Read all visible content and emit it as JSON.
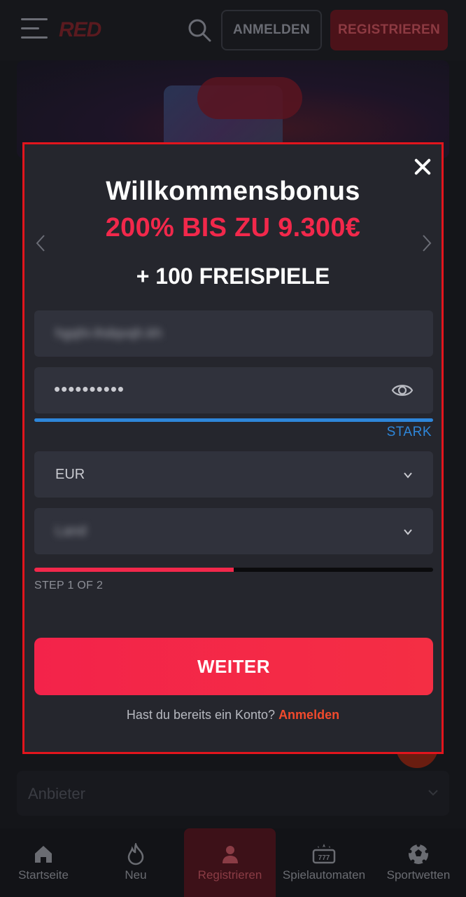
{
  "header": {
    "logo_text": "RED",
    "login_label": "ANMELDEN",
    "register_label": "REGISTRIEREN"
  },
  "modal": {
    "title": "Willkommensbonus",
    "subtitle": "200% BIS ZU 9.300€",
    "freespins": "+ 100 FREISPIELE",
    "fields": {
      "email_value": "hgqhi-ihdqvqh.kh",
      "password_dots": "••••••••••",
      "password_strength": "STARK",
      "currency_value": "EUR",
      "country_value": "Land"
    },
    "progress": {
      "fraction": 0.5,
      "step_label": "STEP 1 OF 2"
    },
    "submit_label": "WEITER",
    "footer_prompt": "Hast du bereits ein Konto?",
    "footer_link": "Anmelden"
  },
  "filter": {
    "label": "Anbieter"
  },
  "bottom_nav": [
    {
      "label": "Startseite",
      "icon": "home-icon"
    },
    {
      "label": "Neu",
      "icon": "flame-icon"
    },
    {
      "label": "Registrieren",
      "icon": "user-icon"
    },
    {
      "label": "Spielautomaten",
      "icon": "slot-machine-icon"
    },
    {
      "label": "Sportwetten",
      "icon": "soccer-ball-icon"
    }
  ],
  "colors": {
    "accent": "#f2284b",
    "modal_border": "#e2151d",
    "strength": "#2e86d9",
    "link": "#f24a2c"
  }
}
